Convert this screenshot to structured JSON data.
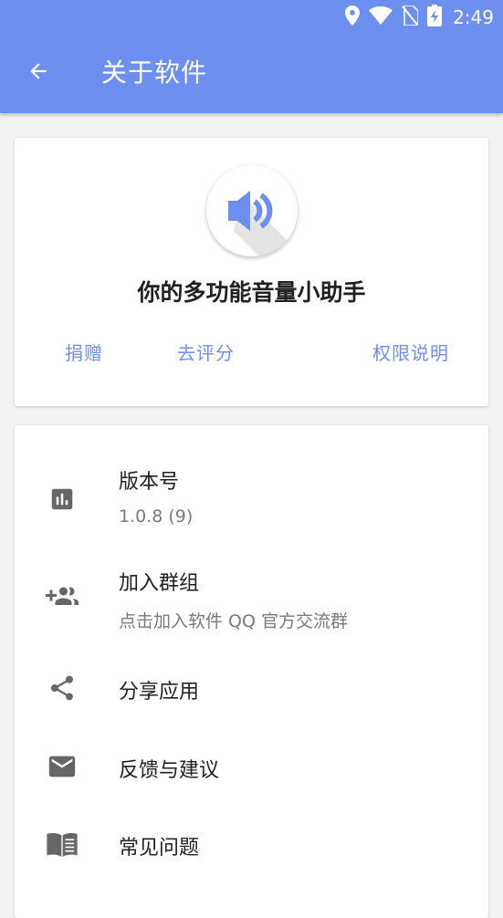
{
  "status_bar": {
    "time": "2:49",
    "icons": [
      "location-icon",
      "wifi-icon",
      "no-sim-icon",
      "battery-charging-icon"
    ]
  },
  "app_bar": {
    "back_icon": "arrow-back-icon",
    "title": "关于软件"
  },
  "about_card": {
    "app_icon": "speaker-volume-icon",
    "tagline": "你的多功能音量小助手",
    "actions": [
      {
        "label": "捐赠"
      },
      {
        "label": "去评分"
      },
      {
        "label": "权限说明"
      }
    ]
  },
  "list": {
    "items": [
      {
        "icon": "bar-chart-icon",
        "title": "版本号",
        "subtitle": "1.0.8 (9)"
      },
      {
        "icon": "group-add-icon",
        "title": "加入群组",
        "subtitle": "点击加入软件 QQ 官方交流群"
      },
      {
        "icon": "share-icon",
        "title": "分享应用"
      },
      {
        "icon": "mail-icon",
        "title": "反馈与建议"
      },
      {
        "icon": "book-icon",
        "title": "常见问题"
      }
    ]
  },
  "colors": {
    "primary": "#6d8ff0",
    "icon_gray": "#666666",
    "background": "#f2f2f2"
  }
}
